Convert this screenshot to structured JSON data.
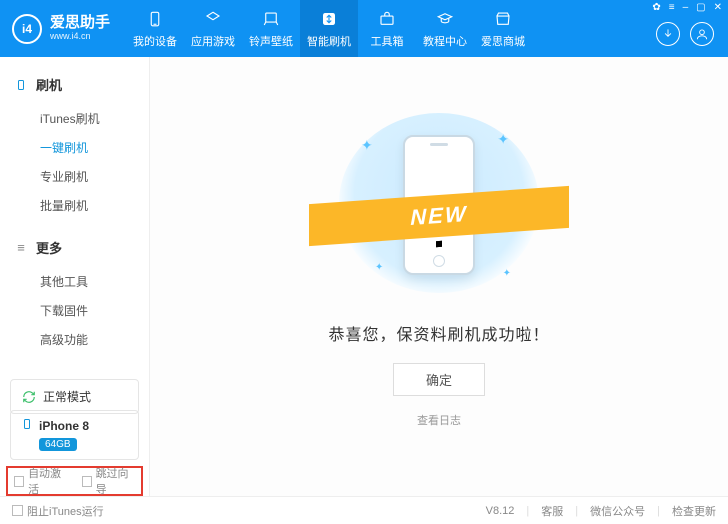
{
  "app": {
    "title": "爱思助手",
    "url": "www.i4.cn"
  },
  "sys_tray": {
    "a": "✿",
    "b": "≡",
    "c": "–",
    "d": "▢",
    "e": "✕"
  },
  "nav": [
    {
      "label": "我的设备"
    },
    {
      "label": "应用游戏"
    },
    {
      "label": "铃声壁纸"
    },
    {
      "label": "智能刷机"
    },
    {
      "label": "工具箱"
    },
    {
      "label": "教程中心"
    },
    {
      "label": "爱思商城"
    }
  ],
  "sidebar": {
    "group1": {
      "title": "刷机",
      "items": [
        "iTunes刷机",
        "一键刷机",
        "专业刷机",
        "批量刷机"
      ]
    },
    "group2": {
      "title": "更多",
      "items": [
        "其他工具",
        "下载固件",
        "高级功能"
      ]
    }
  },
  "status": {
    "label": "正常模式"
  },
  "device": {
    "name": "iPhone 8",
    "capacity": "64GB"
  },
  "checks": {
    "auto_activate": "自动激活",
    "skip_wizard": "跳过向导"
  },
  "main": {
    "ribbon_text": "NEW",
    "success": "恭喜您，保资料刷机成功啦！",
    "ok": "确定",
    "log": "查看日志"
  },
  "footer": {
    "block_itunes": "阻止iTunes运行",
    "version": "V8.12",
    "support": "客服",
    "wechat": "微信公众号",
    "update": "检查更新"
  }
}
